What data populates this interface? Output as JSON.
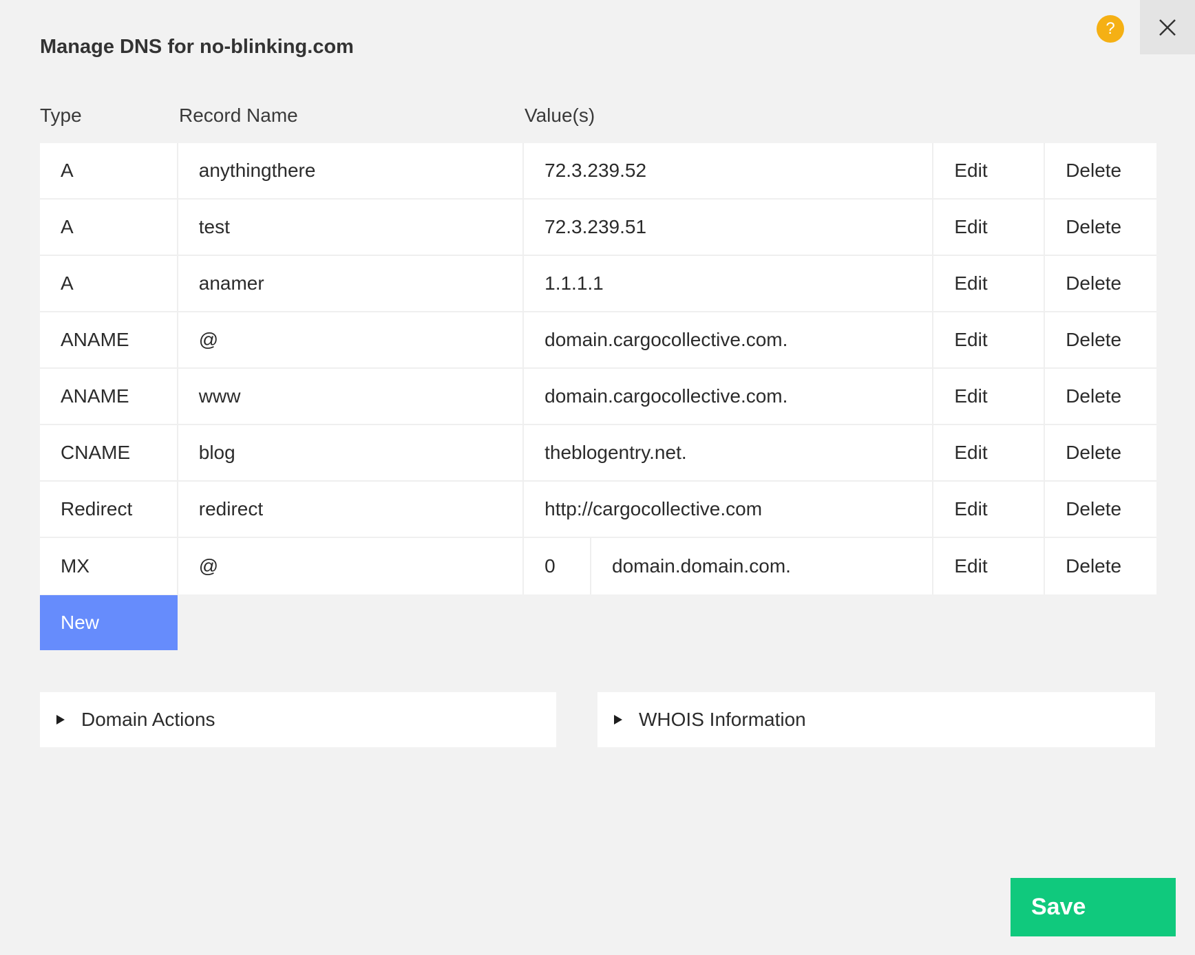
{
  "dialog": {
    "title": "Manage DNS for no-blinking.com",
    "help_symbol": "?",
    "accent_help": "#f5b014"
  },
  "table": {
    "columns": [
      "Type",
      "Record Name",
      "Value(s)"
    ],
    "rows": [
      {
        "type": "A",
        "name": "anythingthere",
        "value": "72.3.239.52",
        "edit": "Edit",
        "delete": "Delete"
      },
      {
        "type": "A",
        "name": "test",
        "value": "72.3.239.51",
        "edit": "Edit",
        "delete": "Delete"
      },
      {
        "type": "A",
        "name": "anamer",
        "value": "1.1.1.1",
        "edit": "Edit",
        "delete": "Delete"
      },
      {
        "type": "ANAME",
        "name": "@",
        "value": "domain.cargocollective.com.",
        "edit": "Edit",
        "delete": "Delete"
      },
      {
        "type": "ANAME",
        "name": "www",
        "value": "domain.cargocollective.com.",
        "edit": "Edit",
        "delete": "Delete"
      },
      {
        "type": "CNAME",
        "name": "blog",
        "value": "theblogentry.net.",
        "edit": "Edit",
        "delete": "Delete"
      },
      {
        "type": "Redirect",
        "name": "redirect",
        "value": "http://cargocollective.com",
        "edit": "Edit",
        "delete": "Delete"
      },
      {
        "type": "MX",
        "name": "@",
        "priority": "0",
        "value": "domain.domain.com.",
        "edit": "Edit",
        "delete": "Delete"
      }
    ]
  },
  "actions": {
    "new_label": "New",
    "save_label": "Save",
    "new_color": "#668cfc",
    "save_color": "#10c97d"
  },
  "panels": {
    "domain_actions": "Domain Actions",
    "whois": "WHOIS Information"
  }
}
